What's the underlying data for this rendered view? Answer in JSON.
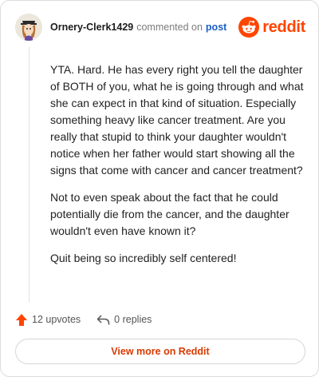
{
  "comment": {
    "username": "Ornery-Clerk1429",
    "action_text": "commented on",
    "post_link_text": "post",
    "paragraphs": [
      "YTA. Hard. He has every right you tell the daughter of BOTH of you, what he is going through and what she can expect in that kind of situation. Especially something heavy like cancer treatment. Are you really that stupid to think your daughter wouldn't notice when her father would start showing all the signs that come with cancer and cancer treatment?",
      "Not to even speak about the fact that he could potentially die from the cancer, and the daughter wouldn't even have known it?",
      "Quit being so incredibly self centered!"
    ]
  },
  "brand": {
    "name": "reddit",
    "color": "#ff4500",
    "icon": "reddit-logo-icon"
  },
  "footer": {
    "upvotes_label": "12 upvotes",
    "replies_label": "0 replies",
    "upvote_icon": "upvote-arrow-icon",
    "reply_icon": "reply-arrow-icon",
    "upvote_color": "#ff4500"
  },
  "view_more": {
    "label": "View more on Reddit",
    "color": "#d93a00"
  }
}
